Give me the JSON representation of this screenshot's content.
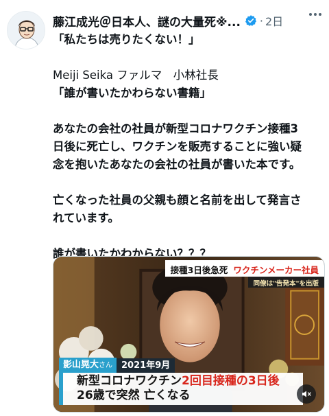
{
  "author": {
    "name": "藤江成光＠日本人、謎の大量死※...",
    "separator": "·",
    "time": "2日"
  },
  "post": {
    "lines": [
      "「私たちは売りたくない！」",
      "",
      "Meiji Seika ファルマ　小林社長",
      "「誰が書いたかわらない書籍」",
      "",
      "あなたの会社の社員が新型コロナワクチン接種3",
      "日後に死亡し、ワクチンを販売することに強い疑",
      "念を抱いたあなたの会社の社員が書いた本です。",
      "",
      "亡くなった社員の父親も顔と名前を出して発言さ",
      "れています。",
      "",
      "誰が書いたかわからない？？？"
    ]
  },
  "media": {
    "top_label_a": "接種3日後急死",
    "top_label_b": "ワクチンメーカー社員",
    "sub_label": "同僚は\"告発本\"を出版",
    "name_tag": "影山晃大",
    "name_suffix": "さん",
    "date_tag": "2021年9月",
    "caption_line1_a": "新型コロナワクチン",
    "caption_line1_b": "2回目接種の3日後",
    "caption_line2": "26歳で突然 亡くなる",
    "accent_color": "#d8261c",
    "tag_color": "#2aa0cc"
  },
  "icons": {
    "verified": "verified-badge-icon",
    "more": "more-options-icon",
    "mute": "muted-speaker-icon"
  }
}
